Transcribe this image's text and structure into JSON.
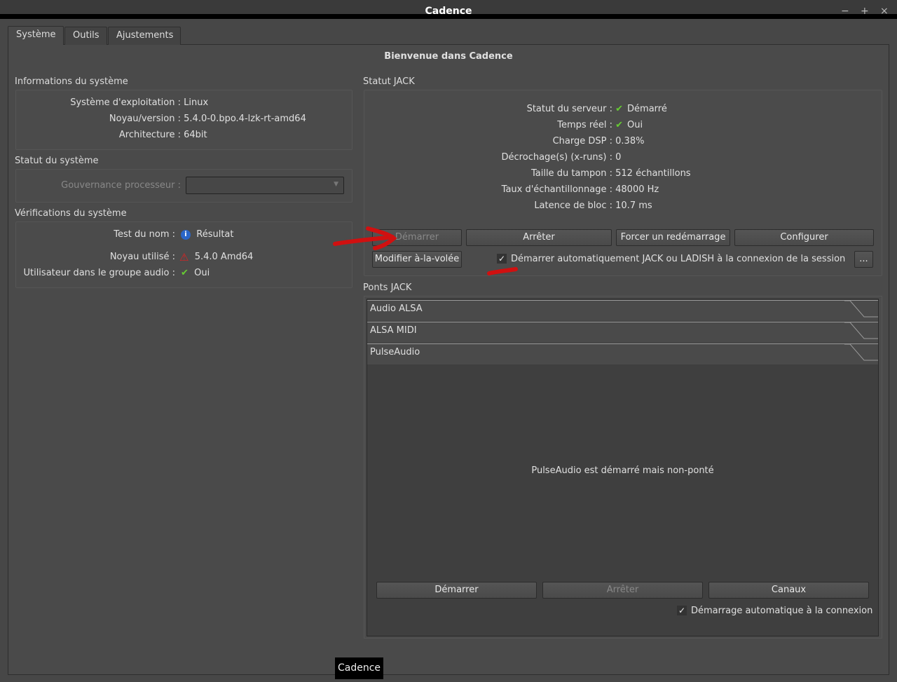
{
  "window": {
    "title": "Cadence",
    "minimize": "−",
    "maximize": "+",
    "close": "×"
  },
  "tabs": [
    "Système",
    "Outils",
    "Ajustements"
  ],
  "heading": "Bienvenue dans Cadence",
  "sysinfo": {
    "title": "Informations du système",
    "rows": [
      {
        "label": "Système d'exploitation :",
        "value": "Linux"
      },
      {
        "label": "Noyau/version :",
        "value": "5.4.0-0.bpo.4-lzk-rt-amd64"
      },
      {
        "label": "Architecture :",
        "value": "64bit"
      }
    ]
  },
  "sysstatus": {
    "title": "Statut du système",
    "governor_label": "Gouvernance processeur :",
    "governor_value": ""
  },
  "checks": {
    "title": "Vérifications du système",
    "rows": [
      {
        "label": "Test du nom :",
        "value": "Résultat",
        "icon": "info"
      },
      {
        "label": "Noyau utilisé :",
        "value": "5.4.0 Amd64",
        "icon": "warning"
      },
      {
        "label": "Utilisateur dans le groupe audio :",
        "value": "Oui",
        "icon": "check"
      }
    ]
  },
  "jack": {
    "title": "Statut JACK",
    "rows": [
      {
        "label": "Statut du serveur :",
        "value": "Démarré"
      },
      {
        "label": "Temps réel :",
        "value": "Oui"
      },
      {
        "label": "Charge DSP :",
        "value": "0.38%"
      },
      {
        "label": "Décrochage(s) (x-runs) :",
        "value": "0"
      },
      {
        "label": "Taille du tampon :",
        "value": "512 échantillons"
      },
      {
        "label": "Taux d'échantillonnage :",
        "value": "48000 Hz"
      },
      {
        "label": "Latence de bloc :",
        "value": "10.7 ms"
      }
    ],
    "start": "Démarrer",
    "stop": "Arrêter",
    "force_restart": "Forcer un redémarrage",
    "configure": "Configurer",
    "modify": "Modifier à-la-volée",
    "autostart": "Démarrer automatiquement JACK ou LADISH à la connexion de la session",
    "more": "...",
    "check": "✓"
  },
  "bridges": {
    "title": "Ponts JACK",
    "items": [
      "Audio ALSA",
      "ALSA MIDI",
      "PulseAudio"
    ],
    "pulse_status": "PulseAudio est démarré mais non-ponté",
    "start": "Démarrer",
    "stop": "Arrêter",
    "channels": "Canaux",
    "autostart": "Démarrage automatique à la connexion",
    "check": "✓"
  },
  "tooltip": "Cadence"
}
